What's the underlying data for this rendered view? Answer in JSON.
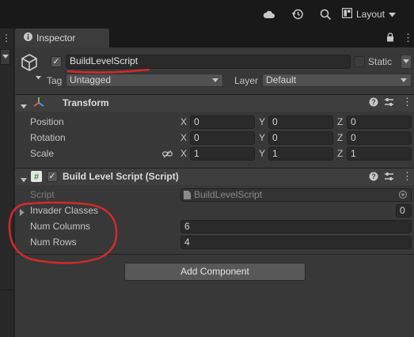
{
  "toolbar": {
    "layout_label": "Layout",
    "icons": [
      "cloud-icon",
      "history-icon",
      "search-icon",
      "layout-icon"
    ]
  },
  "tab": {
    "label": "Inspector"
  },
  "gameobject": {
    "active": true,
    "name": "BuildLevelScript",
    "static_label": "Static",
    "static_checked": false,
    "tag_label": "Tag",
    "tag_value": "Untagged",
    "layer_label": "Layer",
    "layer_value": "Default"
  },
  "transform": {
    "title": "Transform",
    "rows": [
      {
        "label": "Position",
        "x": "0",
        "y": "0",
        "z": "0"
      },
      {
        "label": "Rotation",
        "x": "0",
        "y": "0",
        "z": "0"
      },
      {
        "label": "Scale",
        "x": "1",
        "y": "1",
        "z": "1"
      }
    ],
    "axes": {
      "x": "X",
      "y": "Y",
      "z": "Z"
    }
  },
  "script_component": {
    "enabled": true,
    "title": "Build Level Script (Script)",
    "script_label": "Script",
    "script_value": "BuildLevelScript",
    "fields": [
      {
        "label": "Invader Classes",
        "value": "0"
      },
      {
        "label": "Num Columns",
        "value": "6"
      },
      {
        "label": "Num Rows",
        "value": "4"
      }
    ]
  },
  "add_component_label": "Add Component",
  "colors": {
    "annotation_red": "#d42a2a",
    "panel_bg": "#383838",
    "toolbar_bg": "#191919"
  }
}
